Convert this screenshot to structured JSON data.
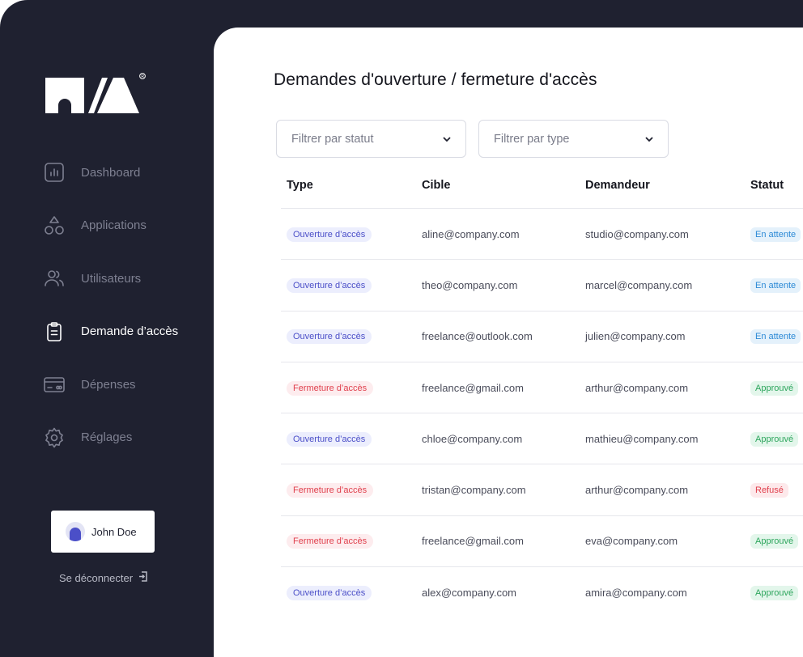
{
  "sidebar": {
    "items": [
      {
        "label": "Dashboard",
        "icon": "chart-icon",
        "active": false
      },
      {
        "label": "Applications",
        "icon": "shapes-icon",
        "active": false
      },
      {
        "label": "Utilisateurs",
        "icon": "users-icon",
        "active": false
      },
      {
        "label": "Demande d’accès",
        "icon": "clipboard-icon",
        "active": true
      },
      {
        "label": "Dépenses",
        "icon": "credit-card-icon",
        "active": false
      },
      {
        "label": "Réglages",
        "icon": "gear-icon",
        "active": false
      }
    ],
    "user": {
      "name": "John Doe"
    },
    "logout_label": "Se déconnecter"
  },
  "main": {
    "title": "Demandes d'ouverture / fermeture d'accès",
    "filters": {
      "status_placeholder": "Filtrer par statut",
      "type_placeholder": "Filtrer par type"
    },
    "table": {
      "columns": [
        "Type",
        "Cible",
        "Demandeur",
        "Statut"
      ],
      "rows": [
        {
          "type": "Ouverture d’accès",
          "type_kind": "open",
          "target": "aline@company.com",
          "requester": "studio@company.com",
          "status": "En attente",
          "status_kind": "pending"
        },
        {
          "type": "Ouverture d’accès",
          "type_kind": "open",
          "target": "theo@company.com",
          "requester": "marcel@company.com",
          "status": "En attente",
          "status_kind": "pending"
        },
        {
          "type": "Ouverture d’accès",
          "type_kind": "open",
          "target": "freelance@outlook.com",
          "requester": "julien@company.com",
          "status": "En attente",
          "status_kind": "pending"
        },
        {
          "type": "Fermeture d’accès",
          "type_kind": "close",
          "target": "freelance@gmail.com",
          "requester": "arthur@company.com",
          "status": "Approuvé",
          "status_kind": "approved"
        },
        {
          "type": "Ouverture d’accès",
          "type_kind": "open",
          "target": "chloe@company.com",
          "requester": "mathieu@company.com",
          "status": "Approuvé",
          "status_kind": "approved"
        },
        {
          "type": "Fermeture d’accès",
          "type_kind": "close",
          "target": "tristan@company.com",
          "requester": "arthur@company.com",
          "status": "Refusé",
          "status_kind": "refused"
        },
        {
          "type": "Fermeture d’accès",
          "type_kind": "close",
          "target": "freelance@gmail.com",
          "requester": "eva@company.com",
          "status": "Approuvé",
          "status_kind": "approved"
        },
        {
          "type": "Ouverture d’accès",
          "type_kind": "open",
          "target": "alex@company.com",
          "requester": "amira@company.com",
          "status": "Approuvé",
          "status_kind": "approved"
        }
      ]
    }
  },
  "colors": {
    "sidebar_bg": "#1f2130",
    "open_tag": "#4b4fc8",
    "close_tag": "#e0404d",
    "pending": "#2d8ad6",
    "approved": "#2ea65d",
    "refused": "#e0404d"
  }
}
